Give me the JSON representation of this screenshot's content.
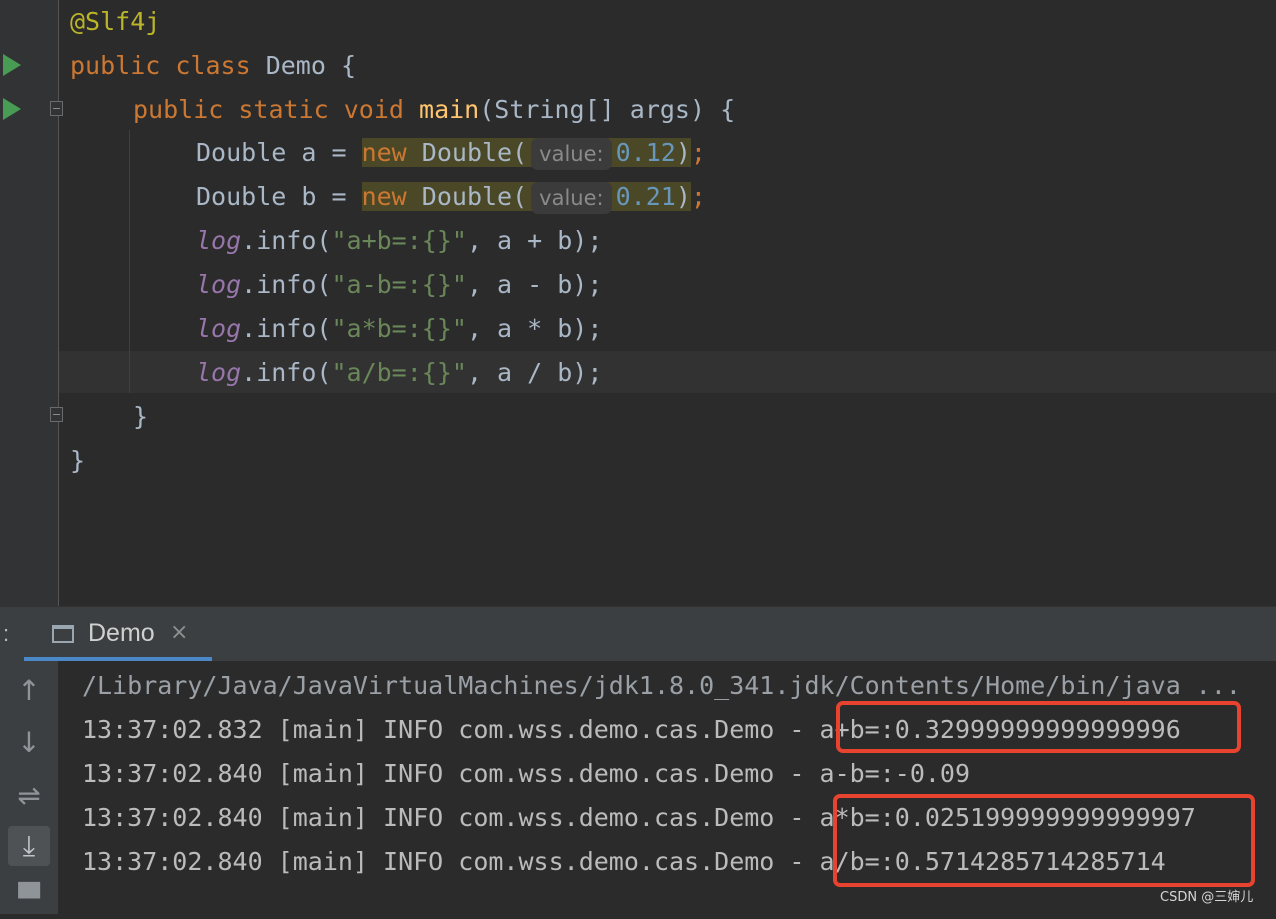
{
  "editor": {
    "annotation": "@Slf4j",
    "class_line": {
      "kw1": "public",
      "kw2": "class",
      "name": "Demo",
      "brace": "{"
    },
    "main_line": {
      "kw1": "public",
      "kw2": "static",
      "kw3": "void",
      "method": "main",
      "params": "(String[] args) {"
    },
    "var_a": {
      "decl": "Double a = ",
      "kw": "new",
      "ctor": " Double(",
      "hint": "value:",
      "value": "0.12",
      "end": ");"
    },
    "var_b": {
      "decl": "Double b = ",
      "kw": "new",
      "ctor": " Double(",
      "hint": "value:",
      "value": "0.21",
      "end": ");"
    },
    "logs": [
      {
        "obj": "log",
        "call": ".info(",
        "str": "\"a+b=:{}\"",
        "args": ", a + b);"
      },
      {
        "obj": "log",
        "call": ".info(",
        "str": "\"a-b=:{}\"",
        "args": ", a - b);"
      },
      {
        "obj": "log",
        "call": ".info(",
        "str": "\"a*b=:{}\"",
        "args": ", a * b);"
      },
      {
        "obj": "log",
        "call": ".info(",
        "str": "\"a/b=:{}\"",
        "args": ", a / b);"
      }
    ],
    "close_method": "}",
    "close_class": "}"
  },
  "run_window": {
    "colon": ":",
    "tab_label": "Demo",
    "tab_close": "×",
    "side_buttons": {
      "up": "↑",
      "down": "↓",
      "wrap": "⇌",
      "scroll_end": "⤓",
      "print": "▀"
    },
    "console": [
      "/Library/Java/JavaVirtualMachines/jdk1.8.0_341.jdk/Contents/Home/bin/java ...",
      "13:37:02.832 [main] INFO com.wss.demo.cas.Demo - a+b=:0.32999999999999996",
      "13:37:02.840 [main] INFO com.wss.demo.cas.Demo - a-b=:-0.09",
      "13:37:02.840 [main] INFO com.wss.demo.cas.Demo - a*b=:0.025199999999999997",
      "13:37:02.840 [main] INFO com.wss.demo.cas.Demo - a/b=:0.5714285714285714"
    ]
  },
  "watermark": "CSDN @三婶儿",
  "colors": {
    "highlight_box": "#e8432e",
    "run_icon": "#499c54",
    "tab_accent": "#4a88c7"
  }
}
